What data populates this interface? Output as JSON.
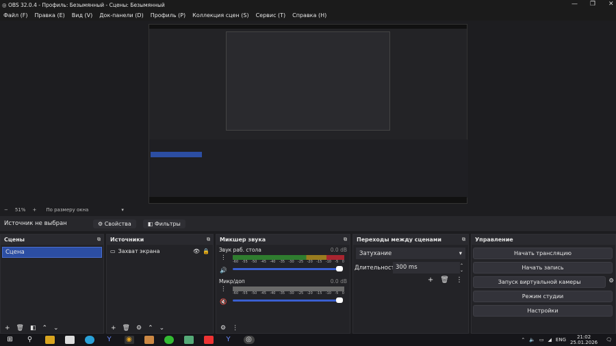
{
  "window": {
    "title": "OBS 32.0.4 - Профиль: Безымянный - Сцены: Безымянный"
  },
  "menu": [
    "Файл (F)",
    "Правка (E)",
    "Вид (V)",
    "Док-панели (D)",
    "Профиль (P)",
    "Коллекция сцен (S)",
    "Сервис (T)",
    "Справка (H)"
  ],
  "zoom": {
    "minus": "−",
    "level": "51%",
    "plus": "+",
    "fit": "По размеру окна"
  },
  "source_bar": {
    "status": "Источник не выбран",
    "properties": "Свойства",
    "filters": "Фильтры"
  },
  "scenes": {
    "title": "Сцены",
    "items": [
      "Сцена"
    ]
  },
  "sources": {
    "title": "Источники",
    "items": [
      "Захват экрана"
    ]
  },
  "mixer": {
    "title": "Микшер звука",
    "ticks": [
      "-60",
      "-55",
      "-50",
      "-45",
      "-40",
      "-35",
      "-30",
      "-25",
      "-20",
      "-15",
      "-10",
      "-5",
      "0"
    ],
    "channels": [
      {
        "name": "Звук раб. стола",
        "level": "0.0 dB",
        "muted": false
      },
      {
        "name": "Микр/доп",
        "level": "0.0 dB",
        "muted": true
      }
    ]
  },
  "transitions": {
    "title": "Переходы между сценами",
    "selected": "Затухание",
    "duration_label": "Длительность",
    "duration": "300 ms"
  },
  "controls": {
    "title": "Управление",
    "buttons": [
      "Начать трансляцию",
      "Начать запись",
      "Запуск виртуальной камеры",
      "Режим студии",
      "Настройки"
    ]
  },
  "tray": {
    "lang": "ENG",
    "time": "21:02",
    "date": "25.01.2026"
  }
}
